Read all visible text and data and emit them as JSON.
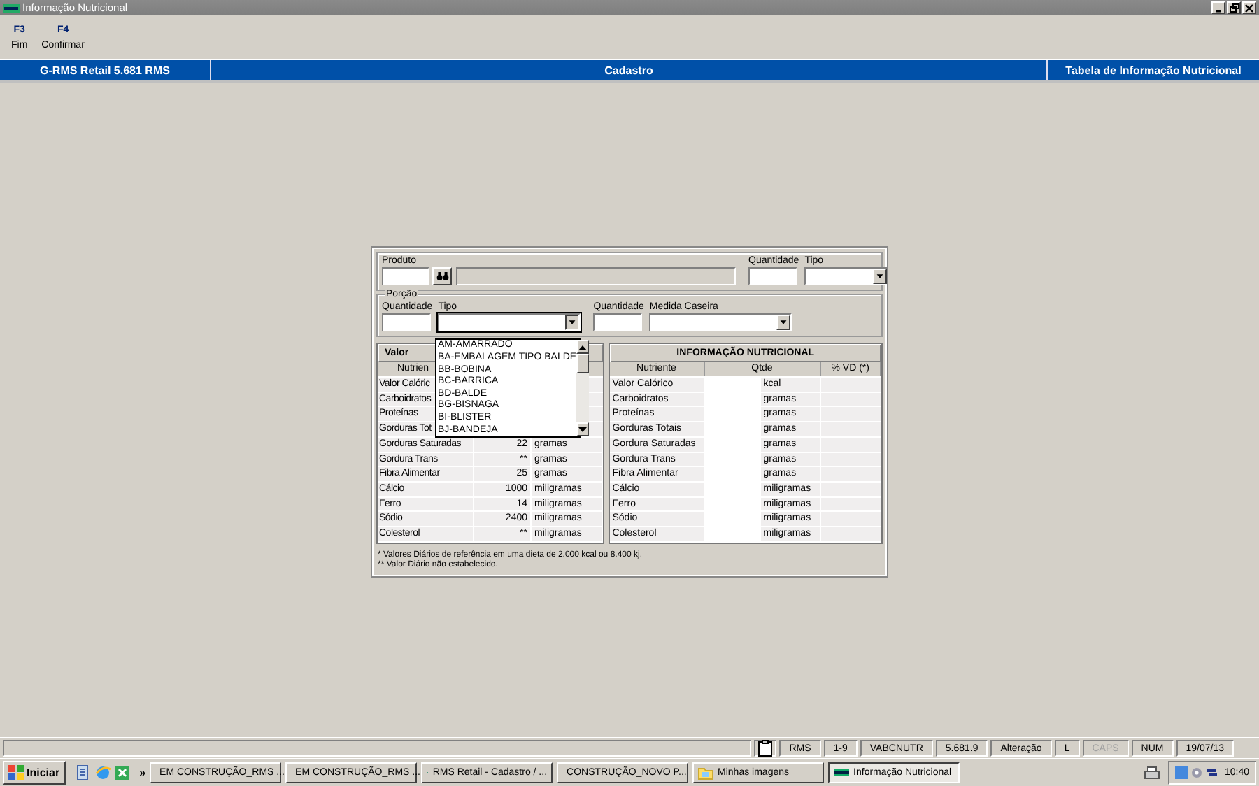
{
  "window": {
    "title": "Informação Nutricional"
  },
  "toolbar": [
    {
      "key": "F3",
      "label": "Fim"
    },
    {
      "key": "F4",
      "label": "Confirmar"
    }
  ],
  "header_bar": {
    "left": "G-RMS Retail 5.681 RMS",
    "center": "Cadastro",
    "right": "Tabela de Informação Nutricional"
  },
  "produto": {
    "label": "Produto",
    "quantidade_label": "Quantidade",
    "tipo_label": "Tipo"
  },
  "porcao": {
    "legend": "Porção",
    "quantidade_label": "Quantidade",
    "tipo_label": "Tipo",
    "tipo_expanded": true,
    "quantidade2_label": "Quantidade",
    "medida_label": "Medida Caseira",
    "tipo_options": [
      "AM-AMARRADO",
      "BA-EMBALAGEM TIPO BALDE",
      "BB-BOBINA",
      "BC-BARRICA",
      "BD-BALDE",
      "BG-BISNAGA",
      "BI-BLISTER",
      "BJ-BANDEJA"
    ]
  },
  "reference_table": {
    "title": "Valor",
    "column_1": "Nutrien",
    "rows": [
      {
        "name": "Valor Calóric"
      },
      {
        "name": "Carboidratos"
      },
      {
        "name": "Proteínas"
      },
      {
        "name": "Gorduras Tot"
      },
      {
        "name": "Gorduras Saturadas",
        "value": "22",
        "unit": "gramas"
      },
      {
        "name": "Gordura Trans",
        "value": "**",
        "unit": "gramas"
      },
      {
        "name": "Fibra Alimentar",
        "value": "25",
        "unit": "gramas"
      },
      {
        "name": "Cálcio",
        "value": "1000",
        "unit": "miligramas"
      },
      {
        "name": "Ferro",
        "value": "14",
        "unit": "miligramas"
      },
      {
        "name": "Sódio",
        "value": "2400",
        "unit": "miligramas"
      },
      {
        "name": "Colesterol",
        "value": "**",
        "unit": "miligramas"
      }
    ]
  },
  "nutrition_table": {
    "title": "INFORMAÇÃO NUTRICIONAL",
    "columns": [
      "Nutriente",
      "Qtde",
      "% VD (*)"
    ],
    "rows": [
      {
        "name": "Valor Calórico",
        "unit": "kcal"
      },
      {
        "name": "Carboidratos",
        "unit": "gramas"
      },
      {
        "name": "Proteínas",
        "unit": "gramas"
      },
      {
        "name": "Gorduras Totais",
        "unit": "gramas"
      },
      {
        "name": "Gordura Saturadas",
        "unit": "gramas"
      },
      {
        "name": "Gordura Trans",
        "unit": "gramas"
      },
      {
        "name": "Fibra Alimentar",
        "unit": "gramas"
      },
      {
        "name": "Cálcio",
        "unit": "miligramas"
      },
      {
        "name": "Ferro",
        "unit": "miligramas"
      },
      {
        "name": "Sódio",
        "unit": "miligramas"
      },
      {
        "name": "Colesterol",
        "unit": "miligramas"
      }
    ]
  },
  "footnotes": [
    "* Valores Diários de referência em uma dieta de 2.000 kcal ou 8.400 kj.",
    "** Valor Diário não estabelecido."
  ],
  "status_bar": [
    {
      "text": "RMS",
      "disabled": false
    },
    {
      "text": "1-9",
      "disabled": false
    },
    {
      "text": "VABCNUTR",
      "disabled": false
    },
    {
      "text": "5.681.9",
      "disabled": false
    },
    {
      "text": "Alteração",
      "disabled": false
    },
    {
      "text": "L",
      "disabled": false
    },
    {
      "text": "CAPS",
      "disabled": true
    },
    {
      "text": "NUM",
      "disabled": false
    },
    {
      "text": "19/07/13",
      "disabled": false
    }
  ],
  "taskbar": {
    "start": "Iniciar",
    "more": "»",
    "tasks": [
      {
        "label": "EM CONSTRUÇÃO_RMS ...",
        "kind": "doc",
        "selected": false
      },
      {
        "label": "EM CONSTRUÇÃO_RMS ...",
        "kind": "doc",
        "selected": false
      },
      {
        "label": "RMS Retail - Cadastro / ...",
        "kind": "app",
        "selected": false
      },
      {
        "label": "CONSTRUÇÃO_NOVO P...",
        "kind": "folder",
        "selected": false
      },
      {
        "label": "Minhas imagens",
        "kind": "images",
        "selected": false
      },
      {
        "label": "Informação Nutricional",
        "kind": "app",
        "selected": true
      }
    ],
    "clock": "10:40"
  }
}
